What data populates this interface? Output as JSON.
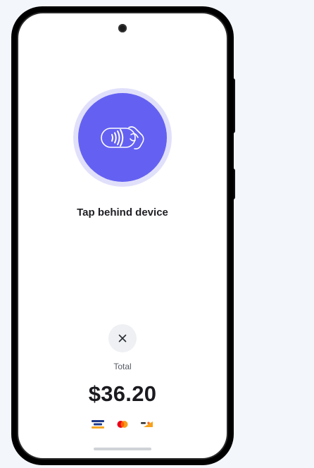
{
  "screen": {
    "prompt": "Tap behind device",
    "cancel_label": "×",
    "total_label": "Total",
    "amount": "$36.20"
  },
  "icons": {
    "nfc": "contactless-tap-icon",
    "cancel": "close-icon",
    "cards": [
      "amex-icon",
      "mastercard-icon",
      "discover-icon"
    ]
  },
  "colors": {
    "accent": "#6461F2",
    "accent_ring": "#E1E0FB",
    "button_bg": "#EEF0F3",
    "text": "#1F1F24"
  }
}
